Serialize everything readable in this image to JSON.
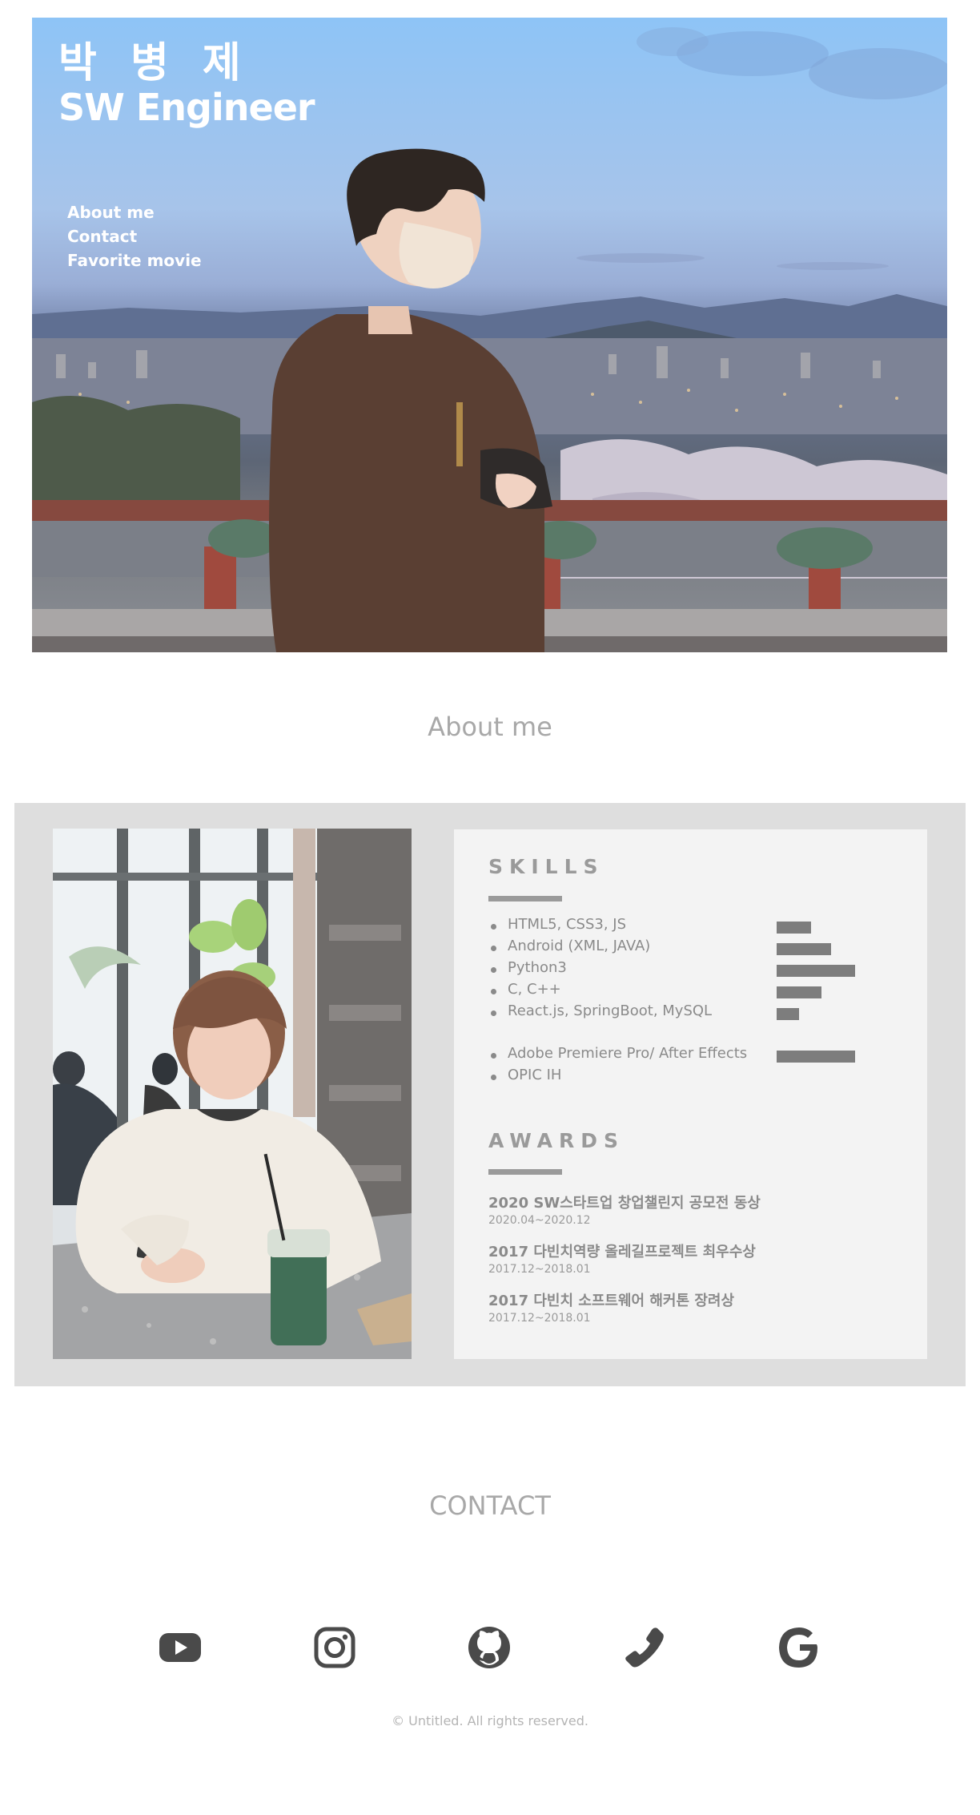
{
  "hero": {
    "name": "박 병 제",
    "role": "SW Engineer",
    "nav": [
      "About me",
      "Contact",
      "Favorite movie"
    ]
  },
  "about": {
    "heading": "About me",
    "skills_title": "SKILLS",
    "skills": [
      {
        "label": "HTML5, CSS3, JS",
        "level": 0.44
      },
      {
        "label": "Android (XML, JAVA)",
        "level": 0.69
      },
      {
        "label": "Python3",
        "level": 1.0
      },
      {
        "label": "C, C++",
        "level": 0.57
      },
      {
        "label": "React.js, SpringBoot, MySQL",
        "level": 0.29
      },
      {
        "label": "Adobe Premiere Pro/ After Effects",
        "level": 1.0
      },
      {
        "label": "OPIC IH",
        "level": 0
      }
    ],
    "awards_title": "AWARDS",
    "awards": [
      {
        "title": "2020 SW스타트업 창업챌린지 공모전 동상",
        "date": "2020.04~2020.12"
      },
      {
        "title": "2017 다빈치역량 올레길프로젝트 최우수상",
        "date": "2017.12~2018.01"
      },
      {
        "title": "2017 다빈치 소프트웨어 해커톤 장려상",
        "date": "2017.12~2018.01"
      }
    ]
  },
  "contact": {
    "heading": "CONTACT",
    "icons": [
      "youtube-icon",
      "instagram-icon",
      "github-icon",
      "phone-icon",
      "google-icon"
    ]
  },
  "footer": {
    "text": "© Untitled. All rights reserved."
  },
  "colors": {
    "icon": "#4a4a4a",
    "heading": "#a8a8a8",
    "panel": "#dedede",
    "card": "#f3f3f3",
    "bar": "#7d7d7d"
  }
}
